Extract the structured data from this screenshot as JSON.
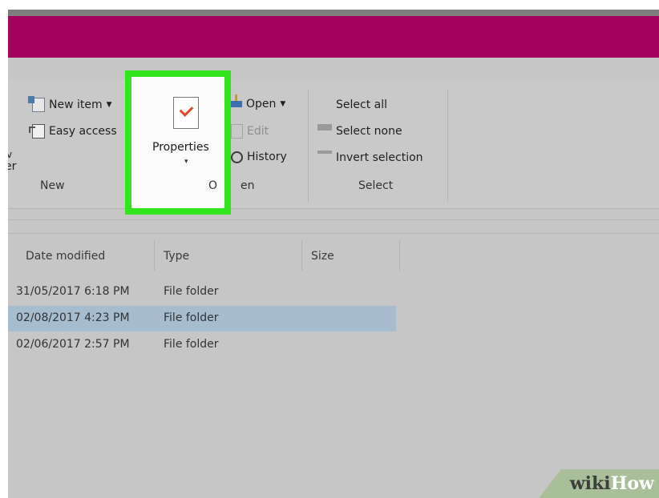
{
  "ribbon": {
    "new_group": {
      "new_item": "New item",
      "easy_access": "Easy access",
      "clip_top": "v",
      "clip_bottom": "er",
      "label": "New"
    },
    "properties": {
      "label": "Properties",
      "caret": "▾",
      "group_fragment_left": "O",
      "group_fragment_right": "en"
    },
    "open_group": {
      "open": "Open",
      "edit": "Edit",
      "history": "History"
    },
    "select_group": {
      "select_all": "Select all",
      "select_none": "Select none",
      "invert_selection": "Invert selection",
      "label": "Select"
    }
  },
  "file_list": {
    "columns": [
      "Date modified",
      "Type",
      "Size"
    ],
    "rows": [
      {
        "date": "31/05/2017 6:18 PM",
        "type": "File folder",
        "selected": false
      },
      {
        "date": "02/08/2017 4:23 PM",
        "type": "File folder",
        "selected": true
      },
      {
        "date": "02/06/2017 2:57 PM",
        "type": "File folder",
        "selected": false
      }
    ]
  },
  "watermark": {
    "part1": "wiki",
    "part2": "How"
  },
  "colors": {
    "title_bar": "#a3005d",
    "highlight": "#33e51c",
    "selected_row": "#a6bccf"
  }
}
